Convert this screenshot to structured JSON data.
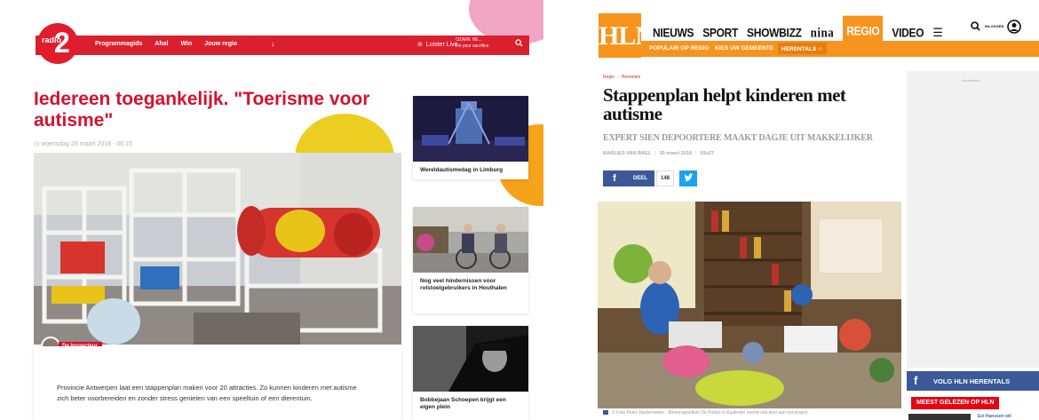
{
  "radio2": {
    "logo_text": "radio",
    "logo_number": "2",
    "nav": [
      "Programmagids",
      "Ahal",
      "Win",
      "Jouw regio"
    ],
    "live_label": "Luister Live",
    "now_playing_artist": "OZARK HE...",
    "now_playing_song": "I'm your sacrifice",
    "title": "Iedereen toegankelijk. \"Toerisme voor autisme\"",
    "date": "woensdag 28 maart 2018 - 08:15",
    "author_tag": "De Inspecteur",
    "intro": "Provincie Antwerpen laat een stappenplan maken voor 20 attracties. Zo kunnen kinderen met autisme zich beter voorbereiden en zonder stress genieten van een speeltuin of een dierentuin.",
    "cards": [
      {
        "caption": "Wereldautismedag in Limburg"
      },
      {
        "caption": "Nog veel hindernissen voor rolstoelgebruikers in Houthalen"
      },
      {
        "caption": "Bobbejaan Schoepen krijgt een eigen plein"
      }
    ],
    "colors": {
      "brand": "#da1f2f",
      "title": "#d4122e"
    }
  },
  "hln": {
    "logo": "HLN",
    "nav": [
      "NIEUWS",
      "SPORT",
      "SHOWBIZZ",
      "nina",
      "REGIO",
      "VIDEO"
    ],
    "active_nav": "REGIO",
    "subnav": [
      "POPULAIR OP REGIO",
      "KIES UW GEMEENTE",
      "HERENTALS ☆"
    ],
    "login_label": "INLOGGEN",
    "breadcrumb": [
      "Regio",
      "Herentals"
    ],
    "title": "Stappenplan helpt kinderen met autisme",
    "subtitle": "EXPERT SIEN DEPOORTERE MAAKT DAGJE UIT MAKKELIJKER",
    "author": "MARLIES VAN BAEL",
    "date": "30 maart 2018",
    "time": "03u27",
    "share_label": "DEEL",
    "share_count": "148",
    "photo_caption": "© Foto Peter Vanderveken - Binnenspeeltuin De Putten in Kasterlee neemt ook deel aan het project.",
    "ad_label": "Advertentie",
    "follow_label": "VOLG HLN HERENTALS",
    "most_read_label": "MEEST GELEZEN OP HLN",
    "teaser_text": "Evi Hanssen wil",
    "colors": {
      "brand": "#f7941d",
      "facebook": "#3b5998",
      "twitter": "#1da1f2",
      "most_read": "#e30613"
    }
  }
}
